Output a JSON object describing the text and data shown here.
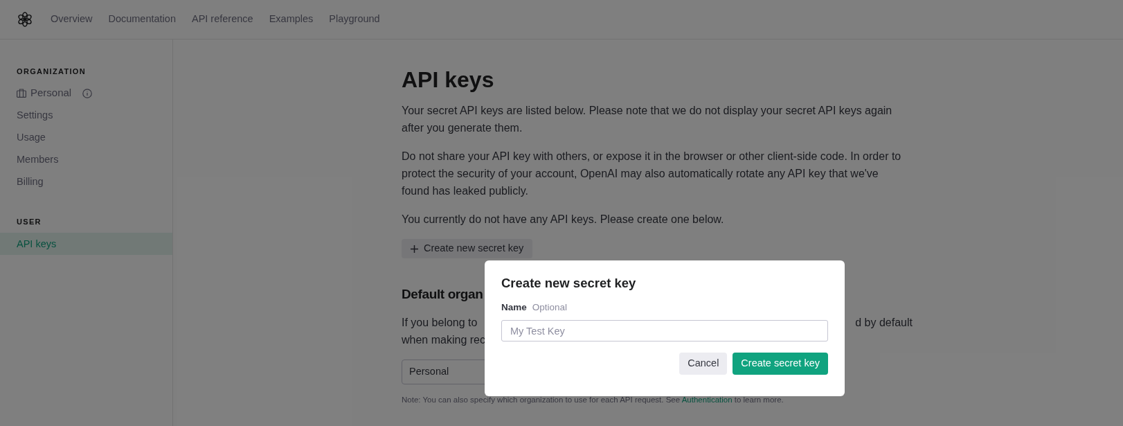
{
  "nav": {
    "items": [
      "Overview",
      "Documentation",
      "API reference",
      "Examples",
      "Playground"
    ]
  },
  "sidebar": {
    "sections": [
      {
        "title": "ORGANIZATION",
        "items": [
          {
            "label": "Personal",
            "kind": "org",
            "selected": false
          },
          {
            "label": "Settings",
            "kind": "link",
            "selected": false
          },
          {
            "label": "Usage",
            "kind": "link",
            "selected": false
          },
          {
            "label": "Members",
            "kind": "link",
            "selected": false
          },
          {
            "label": "Billing",
            "kind": "link",
            "selected": false
          }
        ]
      },
      {
        "title": "USER",
        "items": [
          {
            "label": "API keys",
            "kind": "link",
            "selected": true
          }
        ]
      }
    ]
  },
  "main": {
    "title": "API keys",
    "paragraphs": [
      "Your secret API keys are listed below. Please note that we do not display your secret API keys again after you generate them.",
      "Do not share your API key with others, or expose it in the browser or other client-side code. In order to protect the security of your account, OpenAI may also automatically rotate any API key that we've found has leaked publicly.",
      "You currently do not have any API keys. Please create one below."
    ],
    "create_button": "Create new secret key",
    "default_org": {
      "heading": "Default organ",
      "lines": [
        {
          "left": "If you belong to",
          "right": "d by default"
        },
        {
          "left": "when making rec"
        }
      ],
      "select_value": "Personal",
      "note": {
        "before": "Note: You can also specify which organization to use for each API request. See",
        "link": "Authentication",
        "after": "to learn more."
      }
    }
  },
  "modal": {
    "title": "Create new secret key",
    "field_label": "Name",
    "field_hint": "Optional",
    "placeholder": "My Test Key",
    "buttons": [
      {
        "label": "Cancel",
        "kind": "secondary"
      },
      {
        "label": "Create secret key",
        "kind": "primary"
      }
    ]
  }
}
